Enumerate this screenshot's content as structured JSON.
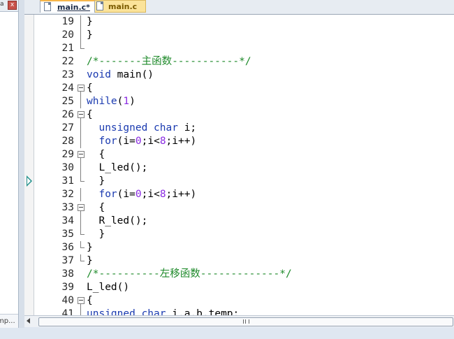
{
  "tabs": [
    {
      "label": "main.c*",
      "active": true
    },
    {
      "label": "main.c",
      "active": false
    }
  ],
  "left_panel": {
    "close_glyph": "x",
    "bottom_text": "mp..."
  },
  "current_line": 31,
  "code_lines": [
    {
      "no": "19",
      "fold": "vline",
      "segments": [
        {
          "t": "}",
          "c": "plain"
        }
      ]
    },
    {
      "no": "20",
      "fold": "vline",
      "segments": [
        {
          "t": "}",
          "c": "plain"
        }
      ]
    },
    {
      "no": "21",
      "fold": "end",
      "segments": []
    },
    {
      "no": "22",
      "fold": "none",
      "segments": [
        {
          "t": "/*-------主函数-----------*/",
          "c": "cm"
        }
      ]
    },
    {
      "no": "23",
      "fold": "none",
      "segments": [
        {
          "t": "void",
          "c": "kw"
        },
        {
          "t": " main()",
          "c": "plain"
        }
      ]
    },
    {
      "no": "24",
      "fold": "box",
      "segments": [
        {
          "t": "{",
          "c": "plain"
        }
      ]
    },
    {
      "no": "25",
      "fold": "vline",
      "segments": [
        {
          "t": "while",
          "c": "kw"
        },
        {
          "t": "(",
          "c": "plain"
        },
        {
          "t": "1",
          "c": "num"
        },
        {
          "t": ")",
          "c": "plain"
        }
      ]
    },
    {
      "no": "26",
      "fold": "box",
      "segments": [
        {
          "t": "{",
          "c": "plain"
        }
      ]
    },
    {
      "no": "27",
      "fold": "vline",
      "segments": [
        {
          "t": "  ",
          "c": "plain"
        },
        {
          "t": "unsigned",
          "c": "kw"
        },
        {
          "t": " ",
          "c": "plain"
        },
        {
          "t": "char",
          "c": "kw"
        },
        {
          "t": " i;",
          "c": "plain"
        }
      ]
    },
    {
      "no": "28",
      "fold": "vline",
      "segments": [
        {
          "t": "  ",
          "c": "plain"
        },
        {
          "t": "for",
          "c": "kw"
        },
        {
          "t": "(i=",
          "c": "plain"
        },
        {
          "t": "0",
          "c": "num"
        },
        {
          "t": ";i<",
          "c": "plain"
        },
        {
          "t": "8",
          "c": "num"
        },
        {
          "t": ";i++)",
          "c": "plain"
        }
      ]
    },
    {
      "no": "29",
      "fold": "box",
      "segments": [
        {
          "t": "  {",
          "c": "plain"
        }
      ]
    },
    {
      "no": "30",
      "fold": "vline",
      "segments": [
        {
          "t": "  L_led();",
          "c": "plain"
        }
      ]
    },
    {
      "no": "31",
      "fold": "end",
      "segments": [
        {
          "t": "  }",
          "c": "plain"
        }
      ]
    },
    {
      "no": "32",
      "fold": "vline",
      "segments": [
        {
          "t": "  ",
          "c": "plain"
        },
        {
          "t": "for",
          "c": "kw"
        },
        {
          "t": "(i=",
          "c": "plain"
        },
        {
          "t": "0",
          "c": "num"
        },
        {
          "t": ";i<",
          "c": "plain"
        },
        {
          "t": "8",
          "c": "num"
        },
        {
          "t": ";i++)",
          "c": "plain"
        }
      ]
    },
    {
      "no": "33",
      "fold": "box",
      "segments": [
        {
          "t": "  {",
          "c": "plain"
        }
      ]
    },
    {
      "no": "34",
      "fold": "vline",
      "segments": [
        {
          "t": "  R_led();",
          "c": "plain"
        }
      ]
    },
    {
      "no": "35",
      "fold": "end",
      "segments": [
        {
          "t": "  }",
          "c": "plain"
        }
      ]
    },
    {
      "no": "36",
      "fold": "end",
      "segments": [
        {
          "t": "}",
          "c": "plain"
        }
      ]
    },
    {
      "no": "37",
      "fold": "end",
      "segments": [
        {
          "t": "}",
          "c": "plain"
        }
      ]
    },
    {
      "no": "38",
      "fold": "none",
      "segments": [
        {
          "t": "/*----------左移函数-------------*/",
          "c": "cm"
        }
      ]
    },
    {
      "no": "39",
      "fold": "none",
      "segments": [
        {
          "t": "L_led()",
          "c": "plain"
        }
      ]
    },
    {
      "no": "40",
      "fold": "box",
      "segments": [
        {
          "t": "{",
          "c": "plain"
        }
      ]
    },
    {
      "no": "41",
      "fold": "vline",
      "segments": [
        {
          "t": "unsigned",
          "c": "kw"
        },
        {
          "t": " ",
          "c": "plain"
        },
        {
          "t": "char",
          "c": "kw"
        },
        {
          "t": " i,a,b,temp;",
          "c": "plain"
        }
      ]
    }
  ],
  "colors": {
    "keyword": "#1a3ab0",
    "comment": "#1e8a2a",
    "number": "#8a2be2",
    "tab_active_accent": "#f6b64a",
    "tab_inactive_bg": "#fbe39a"
  },
  "icons": [
    "file-icon",
    "close-icon",
    "current-line-arrow-icon",
    "scroll-left-arrow-icon",
    "scroll-grip-icon",
    "fold-toggle-icon"
  ]
}
